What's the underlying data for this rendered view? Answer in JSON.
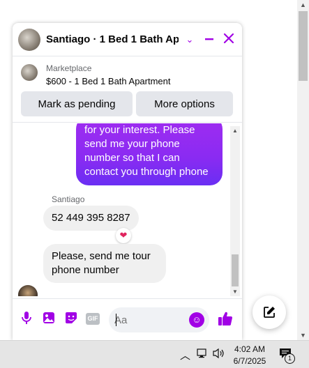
{
  "chat": {
    "title": "Santiago · 1 Bed 1 Bath Ap...",
    "header_icons": [
      "chevron-down-icon",
      "minimize-icon",
      "close-icon"
    ],
    "listing": {
      "source": "Marketplace",
      "item": "$600 - 1 Bed 1 Bath Apartment",
      "buttons": {
        "pending": "Mark as pending",
        "options": "More options"
      }
    },
    "messages": {
      "outgoing": "for your interest. Please send me your phone number so that I can contact you through phone",
      "sender_name": "Santiago",
      "incoming_1": "52 449 395 8287",
      "reaction": "❤",
      "incoming_2": "Please, send me tour phone number"
    },
    "composer": {
      "placeholder": "Aa",
      "gif_label": "GIF"
    }
  },
  "taskbar": {
    "time": "4:02 AM",
    "date": "6/7/2025",
    "notification_count": "1"
  },
  "colors": {
    "accent": "#a100e5",
    "bubble_gradient_top": "#a02cf0",
    "bubble_gradient_bottom": "#6a2ef3"
  }
}
